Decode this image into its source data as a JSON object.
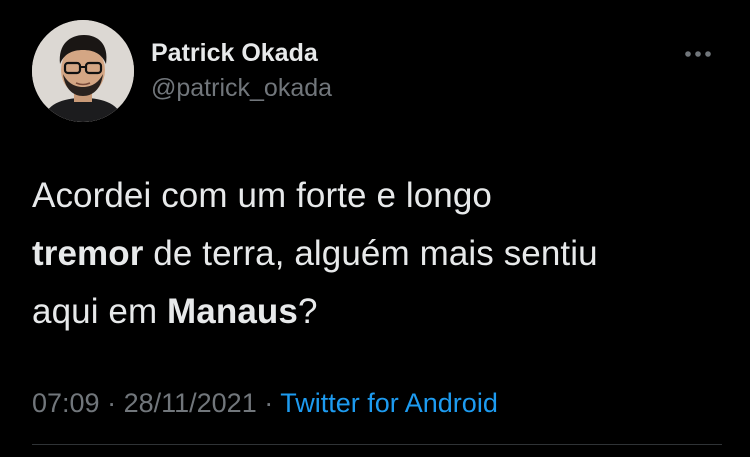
{
  "tweet": {
    "author": {
      "display_name": "Patrick Okada",
      "handle": "@patrick_okada"
    },
    "more_icon": "more-horizontal-icon",
    "text": {
      "line1": "Acordei com um forte e longo",
      "line2_bold": "tremor",
      "line2_rest": " de terra, alguém mais sentiu",
      "line3_start": "aqui em ",
      "line3_bold": "Manaus",
      "line3_end": "?"
    },
    "meta": {
      "time": "07:09",
      "separator1": " · ",
      "date": "28/11/2021",
      "separator2": " · ",
      "source": "Twitter for Android"
    }
  },
  "colors": {
    "background": "#000000",
    "primary_text": "#e7e9ea",
    "secondary_text": "#71767b",
    "link": "#1d9bf0",
    "divider": "#2f3336"
  }
}
